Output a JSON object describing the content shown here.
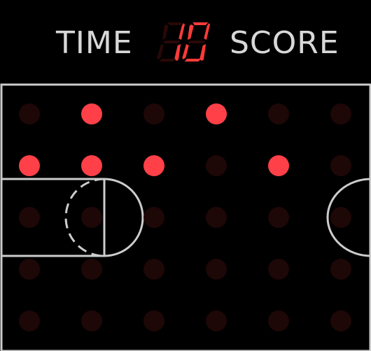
{
  "header": {
    "time_label": "TIME",
    "score_label": "SCORE",
    "display_value": "10"
  },
  "colors": {
    "background": "#000000",
    "lines": "#cccccc",
    "label": "#d8d8d8",
    "led_on": "#ff4048",
    "led_off": "#1e0707",
    "segment_on": "#ff3a3a",
    "segment_off": "#2a0808"
  },
  "grid": {
    "rows": 5,
    "cols": 6,
    "lit": [
      [
        0,
        1
      ],
      [
        0,
        3
      ],
      [
        1,
        0
      ],
      [
        1,
        1
      ],
      [
        1,
        2
      ],
      [
        1,
        4
      ]
    ]
  }
}
